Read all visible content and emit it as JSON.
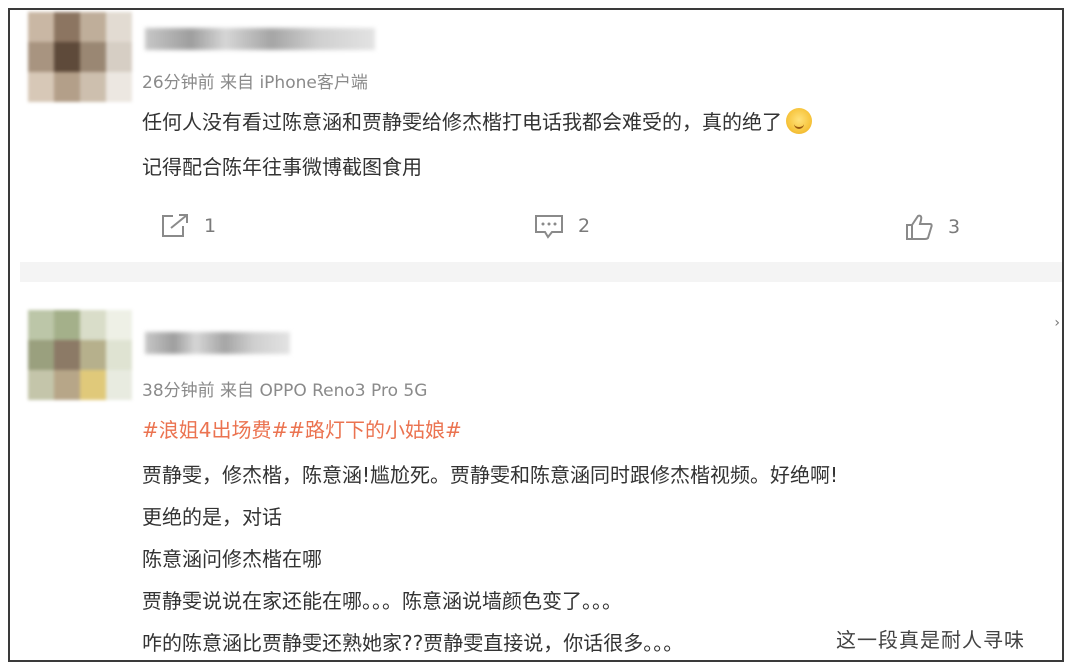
{
  "comments": [
    {
      "meta": "26分钟前  来自 iPhone客户端",
      "lines": [
        "任何人没有看过陈意涵和贾静雯给修杰楷打电话我都会难受的，真的绝了",
        "记得配合陈年往事微博截图食用"
      ],
      "emoji": "hug-face-emoji",
      "actions": {
        "share_count": "1",
        "comment_count": "2",
        "like_count": "3"
      }
    },
    {
      "meta": "38分钟前  来自 OPPO Reno3 Pro 5G",
      "hashtags": "#浪姐4出场费##路灯下的小姑娘#",
      "lines": [
        "贾静雯，修杰楷，陈意涵!尴尬死。贾静雯和陈意涵同时跟修杰楷视频。好绝啊!",
        "更绝的是，对话",
        "陈意涵问修杰楷在哪",
        "贾静雯说说在家还能在哪。。。陈意涵说墙颜色变了。。。",
        "咋的陈意涵比贾静雯还熟她家??贾静雯直接说，你话很多。。。"
      ]
    }
  ],
  "watermark": "这一段真是耐人寻味",
  "colors": {
    "hashtag": "#eb7350",
    "meta": "#8a8a8a",
    "text": "#333333",
    "divider": "#f4f4f4"
  },
  "icons": [
    "share-icon",
    "comment-icon",
    "like-icon"
  ]
}
